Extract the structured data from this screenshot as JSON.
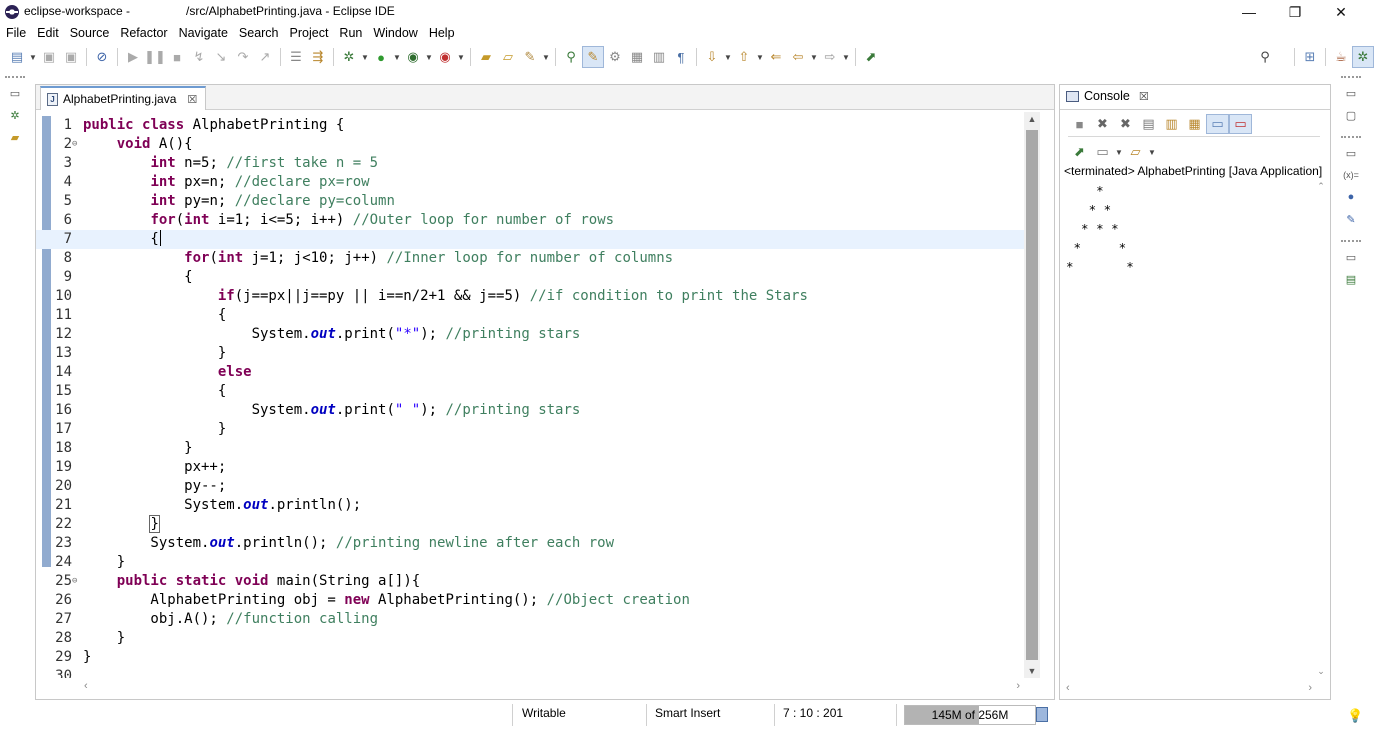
{
  "window": {
    "title_left": "eclipse-workspace -",
    "title_right": "/src/AlphabetPrinting.java - Eclipse IDE",
    "minimize": "—",
    "restore": "❐",
    "close": "✕"
  },
  "menu": [
    "File",
    "Edit",
    "Source",
    "Refactor",
    "Navigate",
    "Search",
    "Project",
    "Run",
    "Window",
    "Help"
  ],
  "editor": {
    "tab_label": "AlphabetPrinting.java",
    "tab_close": "☒",
    "lines": [
      {
        "num": "1",
        "fold": "",
        "html": "<span class=\"kw\">public</span> <span class=\"kw\">class</span> AlphabetPrinting {"
      },
      {
        "num": "2",
        "fold": "⊖",
        "html": "    <span class=\"kw\">void</span> A(){"
      },
      {
        "num": "3",
        "fold": "",
        "html": "        <span class=\"kw\">int</span> n=5; <span class=\"cm\">//first take n = 5</span>"
      },
      {
        "num": "4",
        "fold": "",
        "html": "        <span class=\"kw\">int</span> px=n; <span class=\"cm\">//declare px=row</span>"
      },
      {
        "num": "5",
        "fold": "",
        "html": "        <span class=\"kw\">int</span> py=n; <span class=\"cm\">//declare py=column</span>"
      },
      {
        "num": "6",
        "fold": "",
        "html": "        <span class=\"kw\">for</span>(<span class=\"kw\">int</span> i=1; i&lt;=5; i++) <span class=\"cm\">//Outer loop for number of rows</span>"
      },
      {
        "num": "7",
        "fold": "",
        "html": "        {<span class=\"caret\"></span>",
        "current": true
      },
      {
        "num": "8",
        "fold": "",
        "html": "            <span class=\"kw\">for</span>(<span class=\"kw\">int</span> j=1; j&lt;10; j++) <span class=\"cm\">//Inner loop for number of columns</span>"
      },
      {
        "num": "9",
        "fold": "",
        "html": "            {"
      },
      {
        "num": "10",
        "fold": "",
        "html": "                <span class=\"kw\">if</span>(j==px||j==py || i==n/2+1 &amp;&amp; j==5) <span class=\"cm\">//if condition to print the Stars</span>"
      },
      {
        "num": "11",
        "fold": "",
        "html": "                {"
      },
      {
        "num": "12",
        "fold": "",
        "html": "                    System.<span class=\"fi\">out</span>.print(<span class=\"st\">\"*\"</span>); <span class=\"cm\">//printing stars</span>"
      },
      {
        "num": "13",
        "fold": "",
        "html": "                }"
      },
      {
        "num": "14",
        "fold": "",
        "html": "                <span class=\"kw\">else</span>"
      },
      {
        "num": "15",
        "fold": "",
        "html": "                {"
      },
      {
        "num": "16",
        "fold": "",
        "html": "                    System.<span class=\"fi\">out</span>.print(<span class=\"st\">\" \"</span>); <span class=\"cm\">//printing stars</span>"
      },
      {
        "num": "17",
        "fold": "",
        "html": "                }"
      },
      {
        "num": "18",
        "fold": "",
        "html": "            }"
      },
      {
        "num": "19",
        "fold": "",
        "html": "            px++;"
      },
      {
        "num": "20",
        "fold": "",
        "html": "            py--;"
      },
      {
        "num": "21",
        "fold": "",
        "html": "            System.<span class=\"fi\">out</span>.println();"
      },
      {
        "num": "22",
        "fold": "",
        "html": "        <span class=\"bracket-box\">}</span>"
      },
      {
        "num": "23",
        "fold": "",
        "html": "        System.<span class=\"fi\">out</span>.println(); <span class=\"cm\">//printing newline after each row</span>"
      },
      {
        "num": "24",
        "fold": "",
        "html": "    }"
      },
      {
        "num": "25",
        "fold": "⊖",
        "html": "    <span class=\"kw\">public</span> <span class=\"kw\">static</span> <span class=\"kw\">void</span> main(String a[]){"
      },
      {
        "num": "26",
        "fold": "",
        "html": "        AlphabetPrinting obj = <span class=\"kw\">new</span> AlphabetPrinting(); <span class=\"cm\">//Object creation</span>"
      },
      {
        "num": "27",
        "fold": "",
        "html": "        obj.A(); <span class=\"cm\">//function calling</span>"
      },
      {
        "num": "28",
        "fold": "",
        "html": "    }"
      },
      {
        "num": "29",
        "fold": "",
        "html": "}"
      },
      {
        "num": "30",
        "fold": "",
        "html": ""
      }
    ]
  },
  "console": {
    "tab_label": "Console",
    "tab_close": "☒",
    "status": "<terminated> AlphabetPrinting [Java Application]",
    "output": "    *\n   * *\n  * * *\n *     *\n*       *"
  },
  "statusbar": {
    "writable": "Writable",
    "insert_mode": "Smart Insert",
    "position": "7 : 10 : 201",
    "heap": "145M of 256M",
    "heap_used_fraction": 0.566
  },
  "colors": {
    "keyword": "#7f0055",
    "comment": "#3f7f5f",
    "string": "#2a00ff",
    "field": "#0000c0",
    "current_line": "#e8f2fe"
  }
}
